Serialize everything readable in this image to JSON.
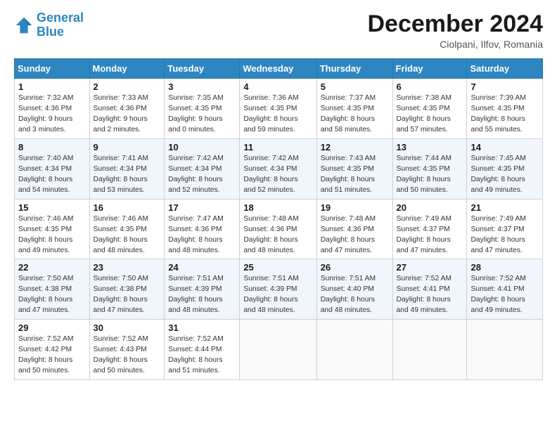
{
  "logo": {
    "line1": "General",
    "line2": "Blue"
  },
  "header": {
    "month": "December 2024",
    "location": "Ciolpani, Ilfov, Romania"
  },
  "weekdays": [
    "Sunday",
    "Monday",
    "Tuesday",
    "Wednesday",
    "Thursday",
    "Friday",
    "Saturday"
  ],
  "weeks": [
    [
      {
        "day": "1",
        "info": "Sunrise: 7:32 AM\nSunset: 4:36 PM\nDaylight: 9 hours\nand 3 minutes."
      },
      {
        "day": "2",
        "info": "Sunrise: 7:33 AM\nSunset: 4:36 PM\nDaylight: 9 hours\nand 2 minutes."
      },
      {
        "day": "3",
        "info": "Sunrise: 7:35 AM\nSunset: 4:35 PM\nDaylight: 9 hours\nand 0 minutes."
      },
      {
        "day": "4",
        "info": "Sunrise: 7:36 AM\nSunset: 4:35 PM\nDaylight: 8 hours\nand 59 minutes."
      },
      {
        "day": "5",
        "info": "Sunrise: 7:37 AM\nSunset: 4:35 PM\nDaylight: 8 hours\nand 58 minutes."
      },
      {
        "day": "6",
        "info": "Sunrise: 7:38 AM\nSunset: 4:35 PM\nDaylight: 8 hours\nand 57 minutes."
      },
      {
        "day": "7",
        "info": "Sunrise: 7:39 AM\nSunset: 4:35 PM\nDaylight: 8 hours\nand 55 minutes."
      }
    ],
    [
      {
        "day": "8",
        "info": "Sunrise: 7:40 AM\nSunset: 4:34 PM\nDaylight: 8 hours\nand 54 minutes."
      },
      {
        "day": "9",
        "info": "Sunrise: 7:41 AM\nSunset: 4:34 PM\nDaylight: 8 hours\nand 53 minutes."
      },
      {
        "day": "10",
        "info": "Sunrise: 7:42 AM\nSunset: 4:34 PM\nDaylight: 8 hours\nand 52 minutes."
      },
      {
        "day": "11",
        "info": "Sunrise: 7:42 AM\nSunset: 4:34 PM\nDaylight: 8 hours\nand 52 minutes."
      },
      {
        "day": "12",
        "info": "Sunrise: 7:43 AM\nSunset: 4:35 PM\nDaylight: 8 hours\nand 51 minutes."
      },
      {
        "day": "13",
        "info": "Sunrise: 7:44 AM\nSunset: 4:35 PM\nDaylight: 8 hours\nand 50 minutes."
      },
      {
        "day": "14",
        "info": "Sunrise: 7:45 AM\nSunset: 4:35 PM\nDaylight: 8 hours\nand 49 minutes."
      }
    ],
    [
      {
        "day": "15",
        "info": "Sunrise: 7:46 AM\nSunset: 4:35 PM\nDaylight: 8 hours\nand 49 minutes."
      },
      {
        "day": "16",
        "info": "Sunrise: 7:46 AM\nSunset: 4:35 PM\nDaylight: 8 hours\nand 48 minutes."
      },
      {
        "day": "17",
        "info": "Sunrise: 7:47 AM\nSunset: 4:36 PM\nDaylight: 8 hours\nand 48 minutes."
      },
      {
        "day": "18",
        "info": "Sunrise: 7:48 AM\nSunset: 4:36 PM\nDaylight: 8 hours\nand 48 minutes."
      },
      {
        "day": "19",
        "info": "Sunrise: 7:48 AM\nSunset: 4:36 PM\nDaylight: 8 hours\nand 47 minutes."
      },
      {
        "day": "20",
        "info": "Sunrise: 7:49 AM\nSunset: 4:37 PM\nDaylight: 8 hours\nand 47 minutes."
      },
      {
        "day": "21",
        "info": "Sunrise: 7:49 AM\nSunset: 4:37 PM\nDaylight: 8 hours\nand 47 minutes."
      }
    ],
    [
      {
        "day": "22",
        "info": "Sunrise: 7:50 AM\nSunset: 4:38 PM\nDaylight: 8 hours\nand 47 minutes."
      },
      {
        "day": "23",
        "info": "Sunrise: 7:50 AM\nSunset: 4:38 PM\nDaylight: 8 hours\nand 47 minutes."
      },
      {
        "day": "24",
        "info": "Sunrise: 7:51 AM\nSunset: 4:39 PM\nDaylight: 8 hours\nand 48 minutes."
      },
      {
        "day": "25",
        "info": "Sunrise: 7:51 AM\nSunset: 4:39 PM\nDaylight: 8 hours\nand 48 minutes."
      },
      {
        "day": "26",
        "info": "Sunrise: 7:51 AM\nSunset: 4:40 PM\nDaylight: 8 hours\nand 48 minutes."
      },
      {
        "day": "27",
        "info": "Sunrise: 7:52 AM\nSunset: 4:41 PM\nDaylight: 8 hours\nand 49 minutes."
      },
      {
        "day": "28",
        "info": "Sunrise: 7:52 AM\nSunset: 4:41 PM\nDaylight: 8 hours\nand 49 minutes."
      }
    ],
    [
      {
        "day": "29",
        "info": "Sunrise: 7:52 AM\nSunset: 4:42 PM\nDaylight: 8 hours\nand 50 minutes."
      },
      {
        "day": "30",
        "info": "Sunrise: 7:52 AM\nSunset: 4:43 PM\nDaylight: 8 hours\nand 50 minutes."
      },
      {
        "day": "31",
        "info": "Sunrise: 7:52 AM\nSunset: 4:44 PM\nDaylight: 8 hours\nand 51 minutes."
      },
      null,
      null,
      null,
      null
    ]
  ]
}
